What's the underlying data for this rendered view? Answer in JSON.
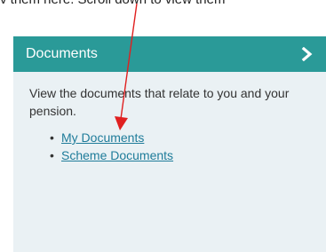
{
  "top_text": "v them here. Scroll down to view them",
  "card": {
    "title": "Documents",
    "description": "View the documents that relate to you and your pension.",
    "links": [
      {
        "label": "My Documents"
      },
      {
        "label": "Scheme Documents"
      }
    ]
  },
  "colors": {
    "header_bg": "#2a9a98",
    "card_bg": "#eaf1f4",
    "link": "#1f7c9a",
    "annotation_arrow": "#e02020"
  },
  "icons": {
    "header_icon": "chevron-right-icon",
    "annotation": "red-arrow-icon"
  }
}
